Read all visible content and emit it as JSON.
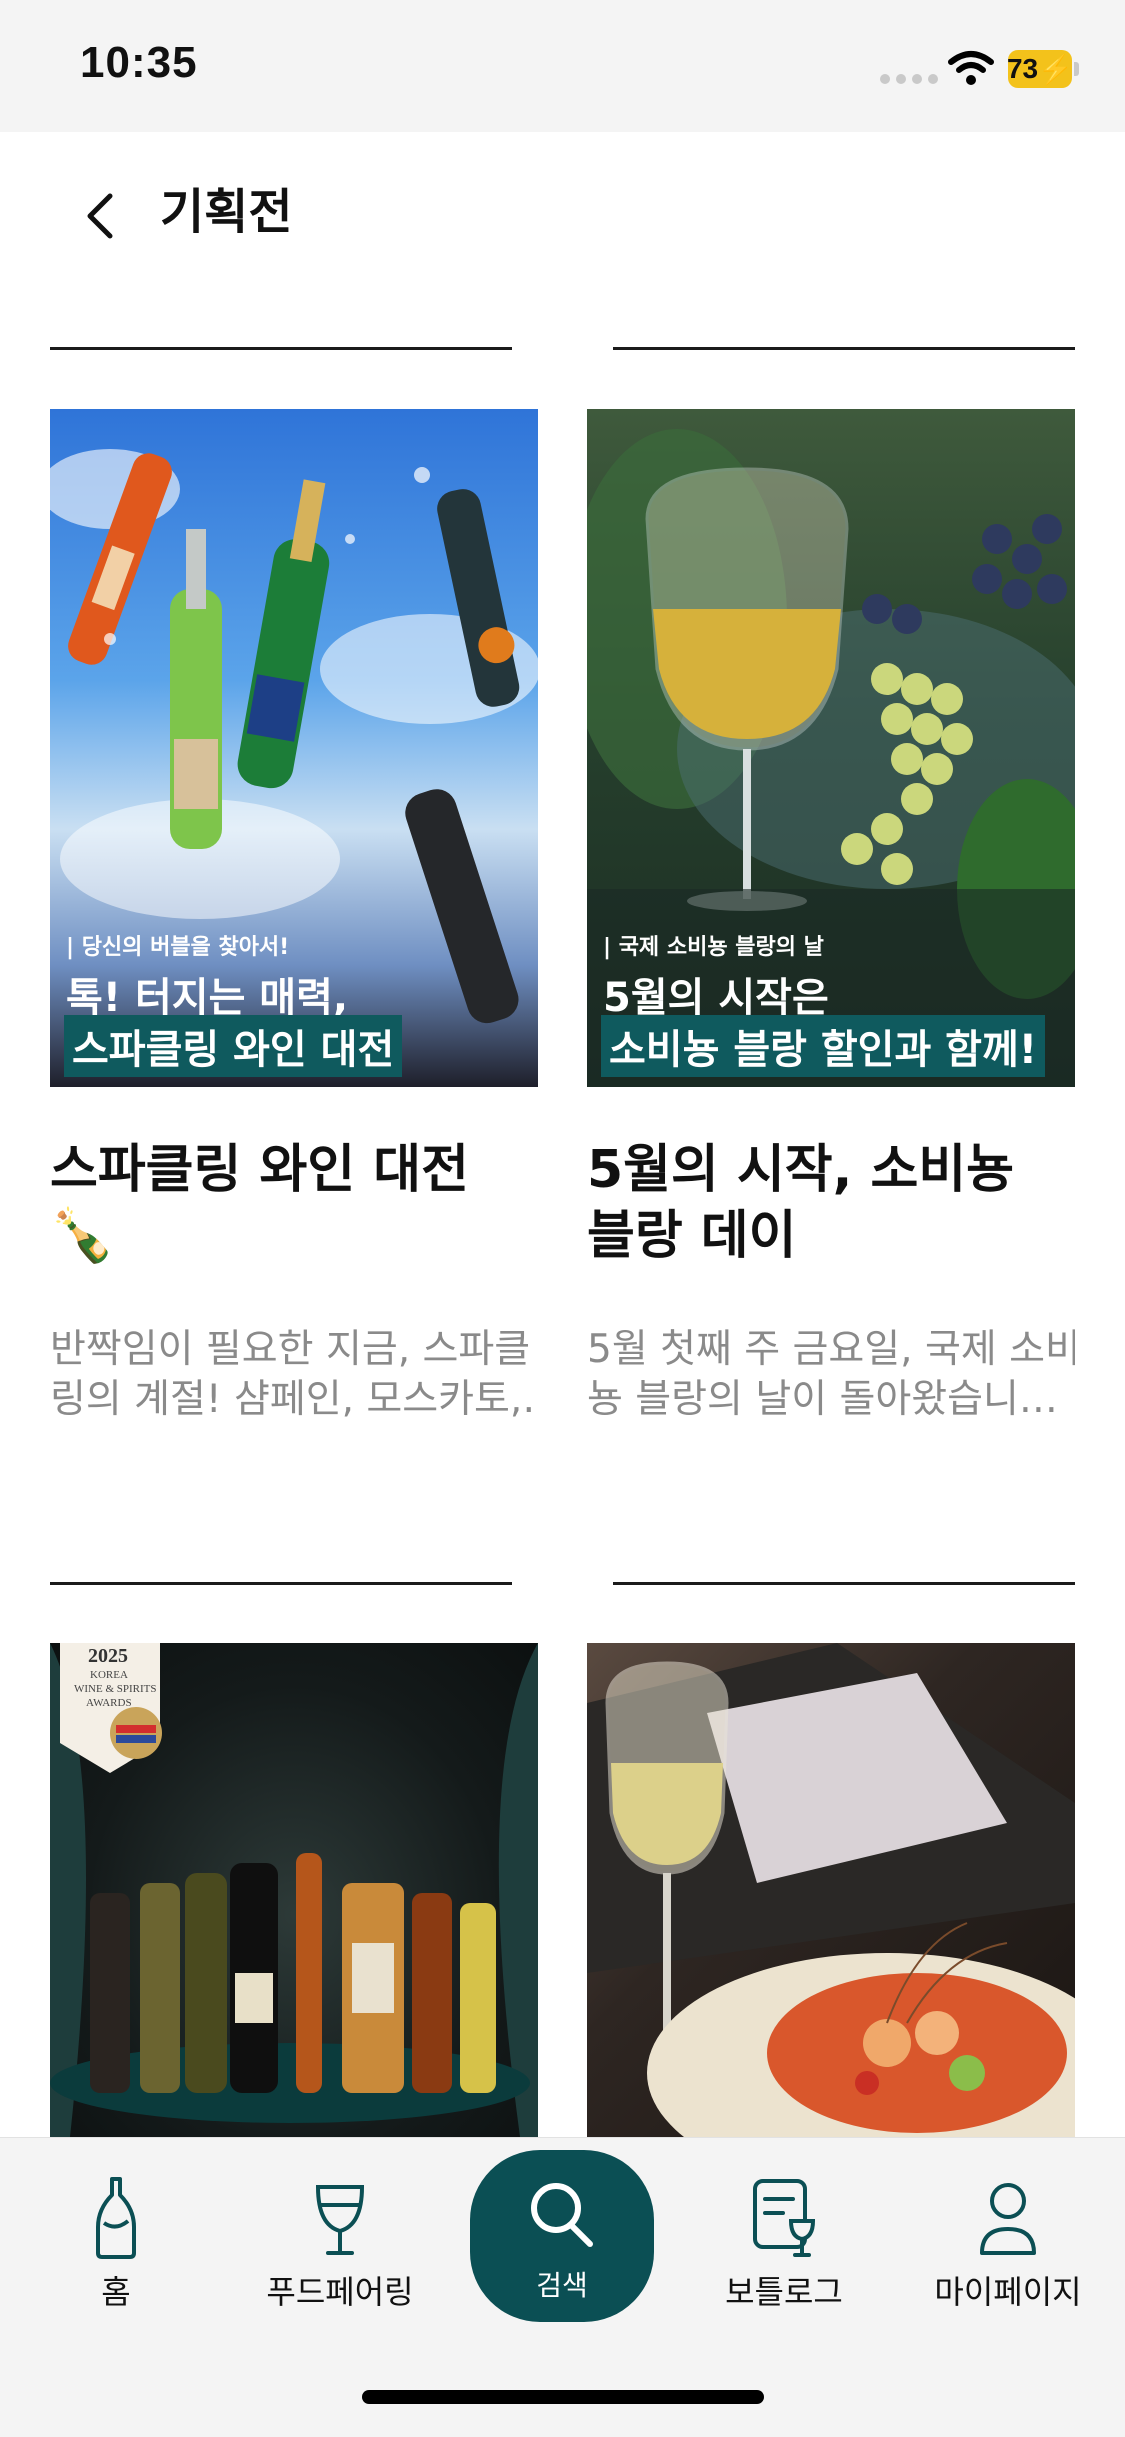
{
  "status_bar": {
    "time": "10:35",
    "battery": "73"
  },
  "header": {
    "title": "기획전"
  },
  "cards": [
    {
      "banner_sub": "| 당신의 버블을 찾아서!",
      "banner_line1": "톡! 터지는 매력,",
      "banner_line2": "스파클링 와인 대전",
      "title_line1": "스파클링 와인 대전",
      "title_line2": "🍾",
      "desc_line1": "반짝임이 필요한 지금, 스파클",
      "desc_line2": "링의 계절! 샴페인, 모스카토,…"
    },
    {
      "banner_sub": "| 국제 소비뇽 블랑의 날",
      "banner_line1": "5월의 시작은",
      "banner_line2": "소비뇽 블랑 할인과 함께!",
      "title_line1": "5월의 시작, 소비뇽",
      "title_line2": "블랑 데이",
      "desc_line1": "5월 첫째 주 금요일, 국제 소비",
      "desc_line2": "뇽 블랑의 날이 돌아왔습니…"
    },
    {
      "award_year": "2025",
      "award_line1": "KOREA",
      "award_line2": "WINE & SPIRITS",
      "award_line3": "AWARDS"
    },
    {}
  ],
  "tab_bar": {
    "items": [
      {
        "label": "홈"
      },
      {
        "label": "푸드페어링"
      },
      {
        "label": "검색"
      },
      {
        "label": "보틀로그"
      },
      {
        "label": "마이페이지"
      }
    ],
    "active_color": "#0b4f54"
  }
}
